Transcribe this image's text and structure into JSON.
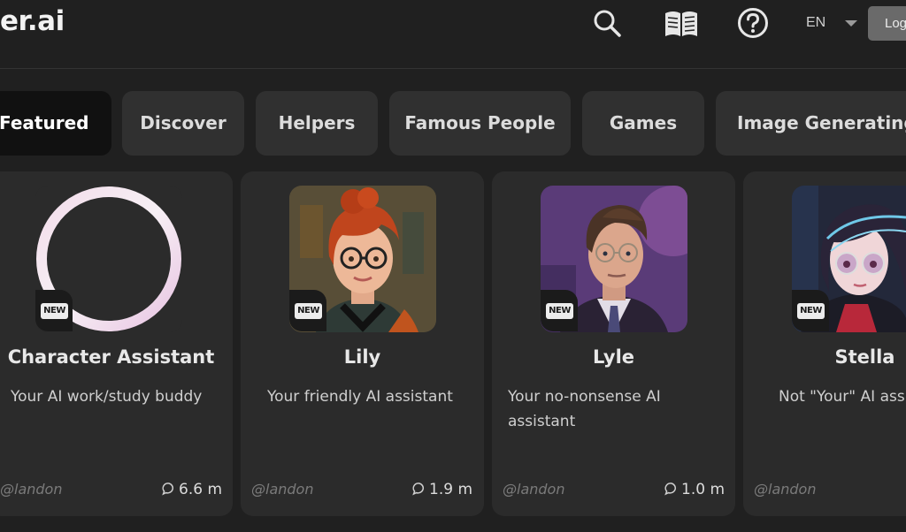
{
  "header": {
    "logo": "er.ai",
    "language": "EN",
    "login_label": "Log"
  },
  "tabs": [
    {
      "label": "Featured",
      "active": true
    },
    {
      "label": "Discover",
      "active": false
    },
    {
      "label": "Helpers",
      "active": false
    },
    {
      "label": "Famous People",
      "active": false
    },
    {
      "label": "Games",
      "active": false
    },
    {
      "label": "Image Generating",
      "active": false
    }
  ],
  "cards": [
    {
      "name": "Character Assistant",
      "description": "Your AI work/study buddy",
      "badge": "NEW",
      "author": "@landon",
      "chats": "6.6 m",
      "avatar": "ring-logo"
    },
    {
      "name": "Lily",
      "description": "Your friendly AI assistant",
      "badge": "NEW",
      "author": "@landon",
      "chats": "1.9 m",
      "avatar": "woman-redhead-glasses"
    },
    {
      "name": "Lyle",
      "description": "Your no-nonsense AI assistant",
      "badge": "NEW",
      "author": "@landon",
      "chats": "1.0 m",
      "avatar": "man-suit"
    },
    {
      "name": "Stella",
      "description": "Not \"Your\" AI ass",
      "badge": "NEW",
      "author": "@landon",
      "chats": "",
      "avatar": "anime-girl-glasses"
    }
  ],
  "icons": {
    "search": "search-icon",
    "book": "book-icon",
    "help": "help-icon",
    "caret": "caret-down-icon",
    "chat": "chat-bubble-icon"
  }
}
